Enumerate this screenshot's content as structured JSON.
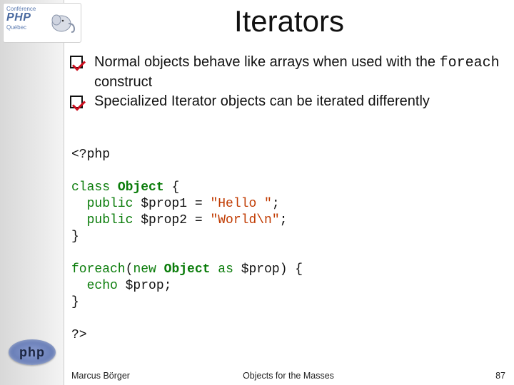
{
  "title": "Iterators",
  "logo": {
    "line1": "Conférence",
    "line2": "PHP",
    "sub": "Québec",
    "pill": "php"
  },
  "bullets": [
    {
      "pre": "Normal objects behave like arrays when used with the ",
      "mono": "foreach",
      "post": " construct"
    },
    {
      "pre": "Specialized Iterator objects can be iterated differently",
      "mono": "",
      "post": ""
    }
  ],
  "code": {
    "open": "<?php",
    "l1a": "class",
    "l1b": "Object",
    "l1c": " {",
    "l2a": "  public ",
    "l2b": "$prop1 = ",
    "l2s": "\"Hello \"",
    "l2c": ";",
    "l3a": "  public ",
    "l3b": "$prop2 = ",
    "l3s": "\"World\\n\"",
    "l3c": ";",
    "l4": "}",
    "l6a": "foreach",
    "l6b": "(",
    "l6c": "new",
    "l6d": " ",
    "l6e": "Object",
    "l6f": " ",
    "l6g": "as",
    "l6h": " $prop) {",
    "l7a": "  echo ",
    "l7b": "$prop;",
    "l8": "}",
    "close": "?>"
  },
  "footer": {
    "left": "Marcus Börger",
    "mid": "Objects for the Masses",
    "right": "87"
  }
}
